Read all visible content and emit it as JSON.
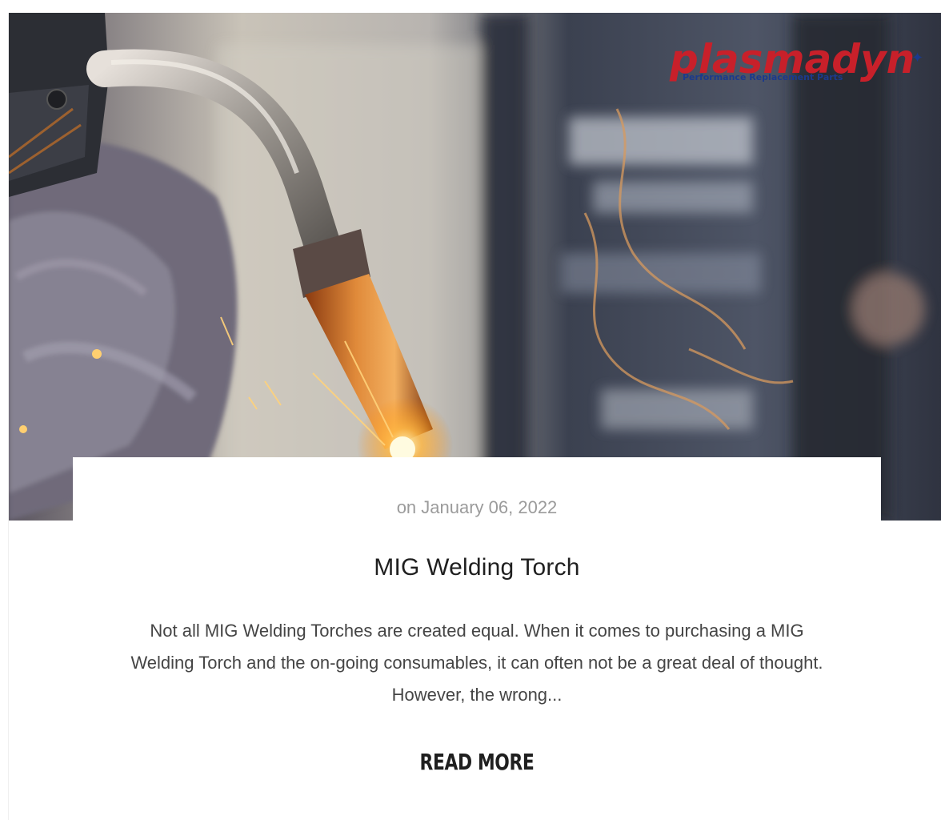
{
  "post": {
    "date": "on January 06, 2022",
    "title": "MIG Welding Torch",
    "excerpt": "Not all MIG Welding Torches are created equal. When it comes to purchasing a MIG Welding Torch and the on-going consumables, it can often not be a great deal of thought. However, the wrong...",
    "read_more_label": "READ MORE"
  },
  "hero": {
    "logo": {
      "name": "plasmadyn",
      "tagline": "Performance Replacement Parts"
    }
  },
  "colors": {
    "logo_red": "#c8202a",
    "logo_blue": "#1b3a8c",
    "date_text": "#9b9b9b",
    "title_text": "#1f1f1f",
    "body_text": "#454545"
  }
}
